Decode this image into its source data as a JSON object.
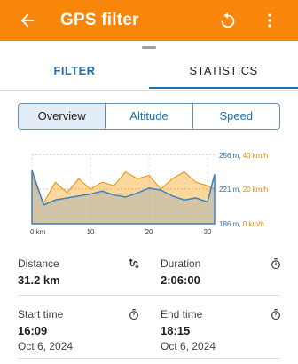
{
  "header": {
    "title": "GPS filter",
    "back_icon": "arrow-left-icon",
    "reset_icon": "reset-icon",
    "menu_icon": "more-vert-icon",
    "color": "#f7860b"
  },
  "tabs": [
    {
      "label": "FILTER",
      "active": false
    },
    {
      "label": "STATISTICS",
      "active": true
    }
  ],
  "segments": [
    {
      "label": "Overview",
      "active": true
    },
    {
      "label": "Altitude",
      "active": false
    },
    {
      "label": "Speed",
      "active": false
    }
  ],
  "chart_data": {
    "type": "area",
    "x_tick_labels": [
      "0 km",
      "10",
      "20",
      "30"
    ],
    "x": [
      0,
      2,
      4,
      6,
      8,
      10,
      12,
      14,
      16,
      18,
      20,
      22,
      24,
      26,
      28,
      30,
      31.2
    ],
    "xlim": [
      0,
      31.2
    ],
    "right_axis_labels": [
      {
        "altitude": "256 m",
        "speed": "40 km/h"
      },
      {
        "altitude": "221 m",
        "speed": "20 km/h"
      },
      {
        "altitude": "186 m",
        "speed": "0 km/h"
      }
    ],
    "series": [
      {
        "name": "",
        "unit": "m",
        "color": "#3f7fbf",
        "values": [
          240,
          205,
          210,
          212,
          214,
          216,
          219,
          215,
          213,
          217,
          222,
          220,
          214,
          210,
          212,
          208,
          236
        ]
      },
      {
        "name": "",
        "unit": "km/h",
        "color": "#f5a623",
        "values": [
          28,
          12,
          24,
          18,
          26,
          20,
          24,
          22,
          30,
          26,
          28,
          20,
          26,
          30,
          24,
          22,
          20
        ]
      }
    ],
    "grid": true
  },
  "stats": {
    "distance": {
      "label": "Distance",
      "value": "31.2 km",
      "icon": "distance-icon"
    },
    "duration": {
      "label": "Duration",
      "value": "2:06:00",
      "icon": "stopwatch-icon"
    },
    "start": {
      "label": "Start time",
      "value": "16:09",
      "date": "Oct 6, 2024",
      "icon": "stopwatch-icon"
    },
    "end": {
      "label": "End time",
      "value": "18:15",
      "date": "Oct 6, 2024",
      "icon": "stopwatch-icon"
    }
  }
}
